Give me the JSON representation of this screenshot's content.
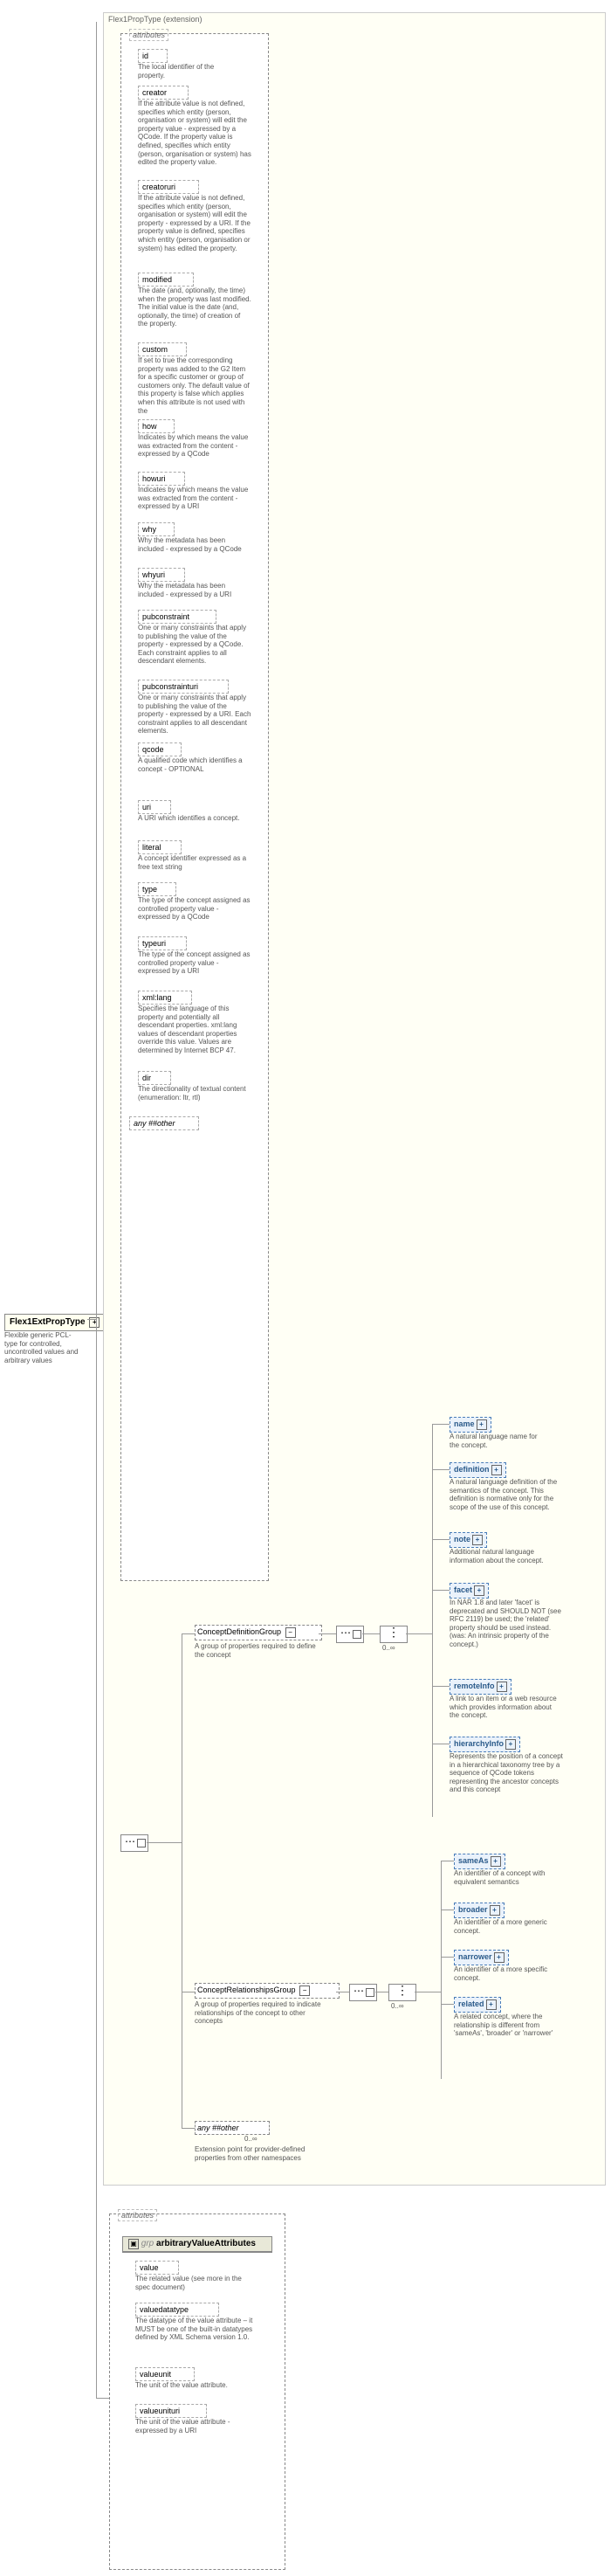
{
  "root": {
    "name": "Flex1ExtPropType",
    "desc": "Flexible generic PCL-type for controlled, uncontrolled values and arbitrary values"
  },
  "extHeader": "Flex1PropType (extension)",
  "attrsLabel": "attributes",
  "attrs": [
    {
      "name": "id",
      "desc": "The local identifier of the property."
    },
    {
      "name": "creator",
      "desc": "If the attribute value is not defined, specifies which entity (person, organisation or system) will edit the property value - expressed by a QCode. If the property value is defined, specifies which entity (person, organisation or system) has edited the property value."
    },
    {
      "name": "creatoruri",
      "desc": "If the attribute value is not defined, specifies which entity (person, organisation or system) will edit the property - expressed by a URI. If the property value is defined, specifies which entity (person, organisation or system) has edited the property."
    },
    {
      "name": "modified",
      "desc": "The date (and, optionally, the time) when the property was last modified. The initial value is the date (and, optionally, the time) of creation of the property."
    },
    {
      "name": "custom",
      "desc": "If set to true the corresponding property was added to the G2 Item for a specific customer or group of customers only. The default value of this property is false which applies when this attribute is not used with the"
    },
    {
      "name": "how",
      "desc": "Indicates by which means the value was extracted from the content - expressed by a QCode"
    },
    {
      "name": "howuri",
      "desc": "Indicates by which means the value was extracted from the content - expressed by a URI"
    },
    {
      "name": "why",
      "desc": "Why the metadata has been included - expressed by a QCode"
    },
    {
      "name": "whyuri",
      "desc": "Why the metadata has been included - expressed by a URI"
    },
    {
      "name": "pubconstraint",
      "desc": "One or many constraints that apply to publishing the value of the property - expressed by a QCode. Each constraint applies to all descendant elements."
    },
    {
      "name": "pubconstrainturi",
      "desc": "One or many constraints that apply to publishing the value of the property - expressed by a URI. Each constraint applies to all descendant elements."
    },
    {
      "name": "qcode",
      "desc": "A qualified code which identifies a concept - OPTIONAL"
    },
    {
      "name": "uri",
      "desc": "A URI which identifies a concept."
    },
    {
      "name": "literal",
      "desc": "A concept identifier expressed as a free text string"
    },
    {
      "name": "type",
      "desc": "The type of the concept assigned as controlled property value - expressed by a QCode"
    },
    {
      "name": "typeuri",
      "desc": "The type of the concept assigned as controlled property value - expressed by a URI"
    },
    {
      "name": "xml:lang",
      "desc": "Specifies the language of this property and potentially all descendant properties. xml:lang values of descendant properties override this value. Values are determined by Internet BCP 47."
    },
    {
      "name": "dir",
      "desc": "The directionality of textual content (enumeration: ltr, rtl)"
    }
  ],
  "anyOther": "any ##other",
  "cdg": {
    "name": "ConceptDefinitionGroup",
    "desc": "A group of properties required to define the concept"
  },
  "crg": {
    "name": "ConceptRelationshipsGroup",
    "desc": "A group of properties required to indicate relationships of the concept to other concepts"
  },
  "cdgItems": [
    {
      "name": "name",
      "desc": "A natural language name for the concept."
    },
    {
      "name": "definition",
      "desc": "A natural language definition of the semantics of the concept. This definition is normative only for the scope of the use of this concept."
    },
    {
      "name": "note",
      "desc": "Additional natural language information about the concept."
    },
    {
      "name": "facet",
      "desc": "In NAR 1.8 and later 'facet' is deprecated and SHOULD NOT (see RFC 2119) be used; the 'related' property should be used instead. (was: An intrinsic property of the concept.)"
    },
    {
      "name": "remoteInfo",
      "desc": "A link to an item or a web resource which provides information about the concept."
    },
    {
      "name": "hierarchyInfo",
      "desc": "Represents the position of a concept in a hierarchical taxonomy tree by a sequence of QCode tokens representing the ancestor concepts and this concept"
    }
  ],
  "crgItems": [
    {
      "name": "sameAs",
      "desc": "An identifier of a concept with equivalent semantics"
    },
    {
      "name": "broader",
      "desc": "An identifier of a more generic concept."
    },
    {
      "name": "narrower",
      "desc": "An identifier of a more specific concept."
    },
    {
      "name": "related",
      "desc": "A related concept, where the relationship is different from 'sameAs', 'broader' or 'narrower'"
    }
  ],
  "anyExt": {
    "name": "any ##other",
    "desc": "Extension point for provider-defined properties from other namespaces"
  },
  "card": "0..∞",
  "ava": {
    "title": "arbitraryValueAttributes",
    "attrsLabel": "attributes",
    "items": [
      {
        "name": "value",
        "desc": "The related value (see more in the spec document)"
      },
      {
        "name": "valuedatatype",
        "desc": "The datatype of the value attribute – it MUST be one of the built-in datatypes defined by XML Schema version 1.0."
      },
      {
        "name": "valueunit",
        "desc": "The unit of the value attribute."
      },
      {
        "name": "valueunituri",
        "desc": "The unit of the value attribute - expressed by a URI"
      }
    ]
  },
  "grpLabel": "grp"
}
